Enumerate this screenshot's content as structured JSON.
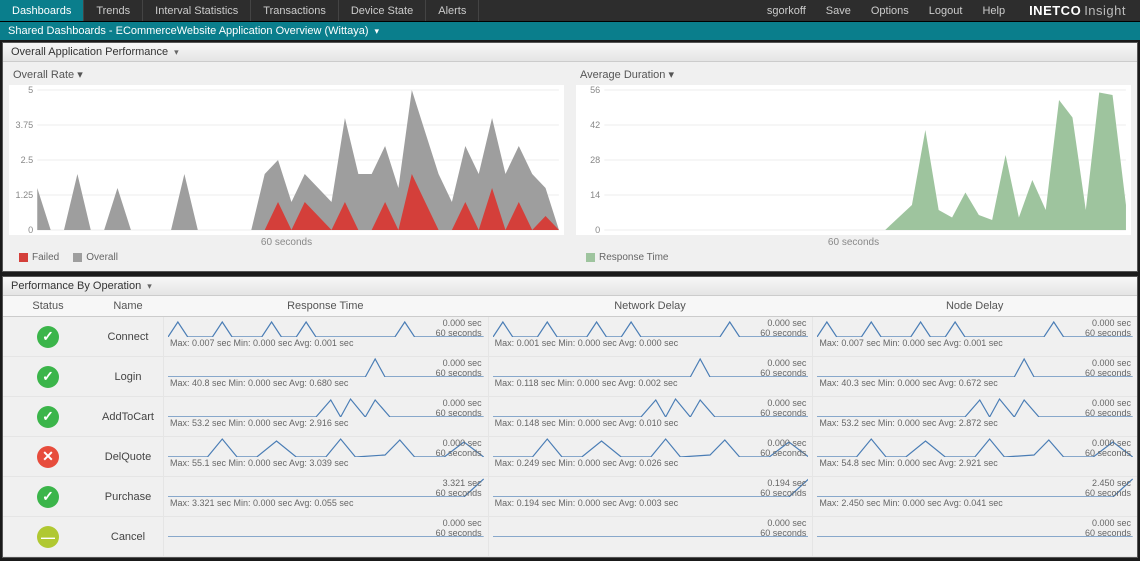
{
  "topbar": {
    "tabs": [
      "Dashboards",
      "Trends",
      "Interval Statistics",
      "Transactions",
      "Device State",
      "Alerts"
    ],
    "active_tab": 0,
    "user": "sgorkoff",
    "menu": [
      "Save",
      "Options",
      "Logout",
      "Help"
    ],
    "logo_main": "INETCO",
    "logo_sub": "Insight"
  },
  "breadcrumb": "Shared Dashboards - ECommerceWebsite Application Overview (Wittaya)",
  "top_panel_title": "Overall Application Performance",
  "left_chart": {
    "title": "Overall Rate",
    "xaxis": "60 seconds",
    "legend": [
      {
        "label": "Failed",
        "color": "#d43f3a"
      },
      {
        "label": "Overall",
        "color": "#9e9e9e"
      }
    ]
  },
  "right_chart": {
    "title": "Average Duration",
    "xaxis": "60 seconds",
    "legend": [
      {
        "label": "Response Time",
        "color": "#9ec49e"
      }
    ]
  },
  "bottom_panel_title": "Performance By Operation",
  "ops_columns": [
    "Status",
    "Name",
    "Response Time",
    "Network Delay",
    "Node Delay"
  ],
  "ops": [
    {
      "status": "ok",
      "name": "Connect",
      "rt": {
        "val": "0.000 sec",
        "sub": "60 seconds",
        "stats": "Max: 0.007 sec  Min: 0.000 sec  Avg: 0.001 sec"
      },
      "net": {
        "val": "0.000 sec",
        "sub": "60 seconds",
        "stats": "Max: 0.001 sec  Min: 0.000 sec  Avg: 0.000 sec"
      },
      "node": {
        "val": "0.000 sec",
        "sub": "60 seconds",
        "stats": "Max: 0.007 sec  Min: 0.000 sec  Avg: 0.001 sec"
      }
    },
    {
      "status": "ok",
      "name": "Login",
      "rt": {
        "val": "0.000 sec",
        "sub": "60 seconds",
        "stats": "Max: 40.8 sec  Min: 0.000 sec  Avg: 0.680 sec"
      },
      "net": {
        "val": "0.000 sec",
        "sub": "60 seconds",
        "stats": "Max: 0.118 sec  Min: 0.000 sec  Avg: 0.002 sec"
      },
      "node": {
        "val": "0.000 sec",
        "sub": "60 seconds",
        "stats": "Max: 40.3 sec  Min: 0.000 sec  Avg: 0.672 sec"
      }
    },
    {
      "status": "ok",
      "name": "AddToCart",
      "rt": {
        "val": "0.000 sec",
        "sub": "60 seconds",
        "stats": "Max: 53.2 sec  Min: 0.000 sec  Avg: 2.916 sec"
      },
      "net": {
        "val": "0.000 sec",
        "sub": "60 seconds",
        "stats": "Max: 0.148 sec  Min: 0.000 sec  Avg: 0.010 sec"
      },
      "node": {
        "val": "0.000 sec",
        "sub": "60 seconds",
        "stats": "Max: 53.2 sec  Min: 0.000 sec  Avg: 2.872 sec"
      }
    },
    {
      "status": "fail",
      "name": "DelQuote",
      "rt": {
        "val": "0.000 sec",
        "sub": "60 seconds",
        "stats": "Max: 55.1 sec  Min: 0.000 sec  Avg: 3.039 sec"
      },
      "net": {
        "val": "0.000 sec",
        "sub": "60 seconds",
        "stats": "Max: 0.249 sec  Min: 0.000 sec  Avg: 0.026 sec"
      },
      "node": {
        "val": "0.000 sec",
        "sub": "60 seconds",
        "stats": "Max: 54.8 sec  Min: 0.000 sec  Avg: 2.921 sec"
      }
    },
    {
      "status": "ok",
      "name": "Purchase",
      "rt": {
        "val": "3.321 sec",
        "sub": "60 seconds",
        "stats": "Max: 3.321 sec  Min: 0.000 sec  Avg: 0.055 sec"
      },
      "net": {
        "val": "0.194 sec",
        "sub": "60 seconds",
        "stats": "Max: 0.194 sec  Min: 0.000 sec  Avg: 0.003 sec"
      },
      "node": {
        "val": "2.450 sec",
        "sub": "60 seconds",
        "stats": "Max: 2.450 sec  Min: 0.000 sec  Avg: 0.041 sec"
      }
    },
    {
      "status": "warn",
      "name": "Cancel",
      "rt": {
        "val": "0.000 sec",
        "sub": "60 seconds",
        "stats": ""
      },
      "net": {
        "val": "0.000 sec",
        "sub": "60 seconds",
        "stats": ""
      },
      "node": {
        "val": "0.000 sec",
        "sub": "60 seconds",
        "stats": ""
      }
    }
  ],
  "chart_data": [
    {
      "type": "area",
      "title": "Overall Rate",
      "xlabel": "60 seconds",
      "ylabel": "",
      "ylim": [
        0,
        5
      ],
      "yticks": [
        0,
        1.25,
        2.5,
        3.75,
        5
      ],
      "series": [
        {
          "name": "Overall",
          "color": "#9e9e9e",
          "values": [
            1.5,
            0,
            0,
            2,
            0,
            0,
            1.5,
            0,
            0,
            0,
            0,
            2,
            0,
            0,
            0,
            0,
            0,
            2,
            2.5,
            1,
            2,
            1.5,
            1,
            4,
            2,
            2,
            3,
            1.5,
            5,
            3.5,
            2,
            1,
            3,
            2,
            4,
            2,
            3,
            2,
            1.5,
            0
          ]
        },
        {
          "name": "Failed",
          "color": "#d43f3a",
          "values": [
            0,
            0,
            0,
            0,
            0,
            0,
            0,
            0,
            0,
            0,
            0,
            0,
            0,
            0,
            0,
            0,
            0,
            0,
            1,
            0,
            1,
            0.5,
            0,
            1,
            0,
            0,
            1,
            0,
            2,
            1,
            0,
            0,
            1,
            0,
            1.5,
            0,
            1,
            0,
            0.5,
            0
          ]
        }
      ]
    },
    {
      "type": "area",
      "title": "Average Duration",
      "xlabel": "60 seconds",
      "ylabel": "",
      "ylim": [
        0,
        56
      ],
      "yticks": [
        0,
        14,
        28,
        42,
        56
      ],
      "series": [
        {
          "name": "Response Time",
          "color": "#9ec49e",
          "values": [
            0,
            0,
            0,
            0,
            0,
            0,
            0,
            0,
            0,
            0,
            0,
            0,
            0,
            0,
            0,
            0,
            0,
            0,
            0,
            0,
            0,
            0,
            5,
            10,
            40,
            8,
            5,
            15,
            6,
            4,
            30,
            5,
            20,
            8,
            52,
            45,
            8,
            55,
            54,
            10
          ]
        }
      ]
    }
  ]
}
